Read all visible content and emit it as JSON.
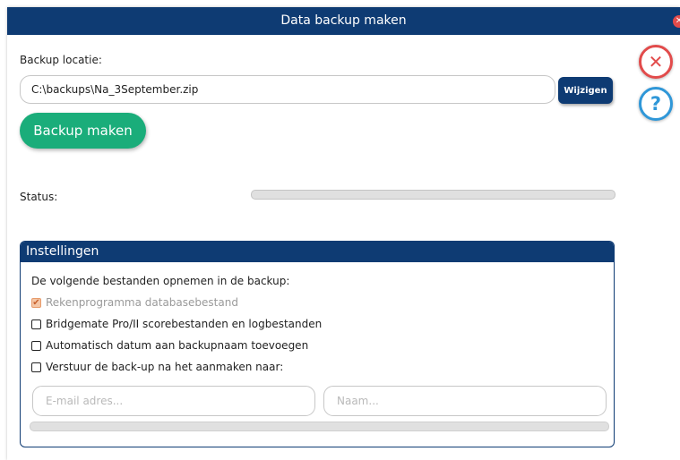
{
  "dialog": {
    "title": "Data backup maken",
    "close_icon": "close-icon",
    "help_icon": "help-icon"
  },
  "backup": {
    "location_label": "Backup locatie:",
    "path_value": "C:\\backups\\Na_3September.zip",
    "change_button_label": "Wijzigen",
    "make_button_label": "Backup maken"
  },
  "status": {
    "label": "Status:",
    "progress": 0
  },
  "settings": {
    "title": "Instellingen",
    "intro": "De volgende bestanden opnemen in de backup:",
    "options": [
      {
        "label": "Rekenprogramma databasebestand",
        "checked": true,
        "disabled": true
      },
      {
        "label": "Bridgemate Pro/II scorebestanden en logbestanden",
        "checked": false,
        "disabled": false
      },
      {
        "label": "Automatisch datum aan backupnaam toevoegen",
        "checked": false,
        "disabled": false
      },
      {
        "label": "Verstuur de back-up na het aanmaken naar:",
        "checked": false,
        "disabled": false
      }
    ],
    "email_placeholder": "E-mail adres...",
    "name_placeholder": "Naam..."
  },
  "colors": {
    "titlebar": "#0e3b73",
    "primary_button": "#1aad7a",
    "close_red": "#e24b4b",
    "help_blue": "#2f97d8"
  }
}
